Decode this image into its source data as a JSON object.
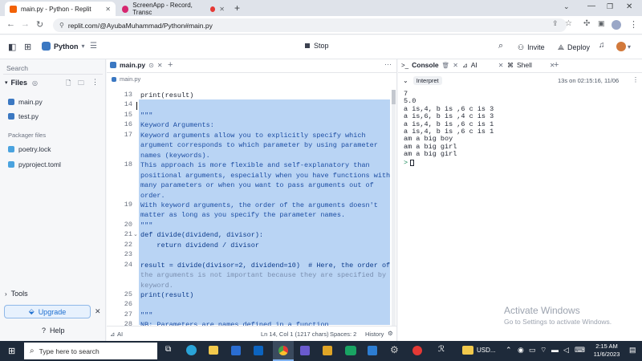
{
  "browser": {
    "tabs": [
      {
        "title": "main.py - Python - Replit",
        "active": true
      },
      {
        "title": "ScreenApp - Record, Transc",
        "active": false
      }
    ],
    "url": "replit.com/@AyubaMuhammad/Python#main.py"
  },
  "header": {
    "repl_name": "Python",
    "stop_label": "Stop",
    "invite_label": "Invite",
    "deploy_label": "Deploy"
  },
  "sidebar": {
    "search_placeholder": "Search",
    "files_label": "Files",
    "files": [
      "main.py",
      "test.py"
    ],
    "packager_label": "Packager files",
    "packager_files": [
      "poetry.lock",
      "pyproject.toml"
    ],
    "tools_label": "Tools",
    "upgrade_label": "Upgrade",
    "help_label": "Help"
  },
  "editor": {
    "tab_label": "main.py",
    "breadcrumb": "main.py",
    "lines": [
      {
        "n": "13",
        "t": "print(result)"
      },
      {
        "n": "14",
        "t": ""
      },
      {
        "n": "15",
        "t": "\"\"\""
      },
      {
        "n": "16",
        "t": "Keyword Arguments:"
      },
      {
        "n": "17",
        "t": "Keyword arguments allow you to explicitly specify which"
      },
      {
        "n": "",
        "t": "argument corresponds to which parameter by using parameter"
      },
      {
        "n": "",
        "t": "names (keywords)."
      },
      {
        "n": "18",
        "t": "This approach is more flexible and self-explanatory than"
      },
      {
        "n": "",
        "t": "positional arguments, especially when you have functions with"
      },
      {
        "n": "",
        "t": "many parameters or when you want to pass arguments out of"
      },
      {
        "n": "",
        "t": "order."
      },
      {
        "n": "19",
        "t": "With keyword arguments, the order of the arguments doesn't"
      },
      {
        "n": "",
        "t": "matter as long as you specify the parameter names."
      },
      {
        "n": "20",
        "t": "\"\"\""
      },
      {
        "n": "21",
        "t": "def divide(dividend, divisor):"
      },
      {
        "n": "22",
        "t": "    return dividend / divisor"
      },
      {
        "n": "23",
        "t": ""
      },
      {
        "n": "24",
        "t": "result = divide(divisor=2, dividend=10)  # Here, the order of"
      },
      {
        "n": "",
        "t": "the arguments is not important because they are specified by"
      },
      {
        "n": "",
        "t": "keyword."
      },
      {
        "n": "25",
        "t": "print(result)"
      },
      {
        "n": "26",
        "t": ""
      },
      {
        "n": "27",
        "t": "\"\"\""
      },
      {
        "n": "28",
        "t": "NB: Parameters are names defined in a function"
      }
    ],
    "status": {
      "ai": "AI",
      "position": "Ln 14, Col 1 (1217 chars)",
      "spaces": "Spaces: 2",
      "history": "History"
    }
  },
  "console": {
    "tabs": [
      "Console",
      "AI",
      "Shell"
    ],
    "interpret_label": "Interpret",
    "timestamp": "13s on 02:15:16, 11/06",
    "output": [
      "7",
      "5.0",
      "a is,4, b is ,6 c is 3",
      "a is,6, b is ,4 c is 3",
      "a is,4, b is ,6 c is 1",
      "a is,4, b is ,6 c is 1",
      "am a big boy",
      "am a big girl",
      "am a big girl"
    ],
    "prompt": ">"
  },
  "watermark": {
    "title": "Activate Windows",
    "subtitle": "Go to Settings to activate Windows."
  },
  "taskbar": {
    "search_placeholder": "Type here to search",
    "currency": "USD...",
    "time": "2:15 AM",
    "date": "11/6/2023"
  }
}
